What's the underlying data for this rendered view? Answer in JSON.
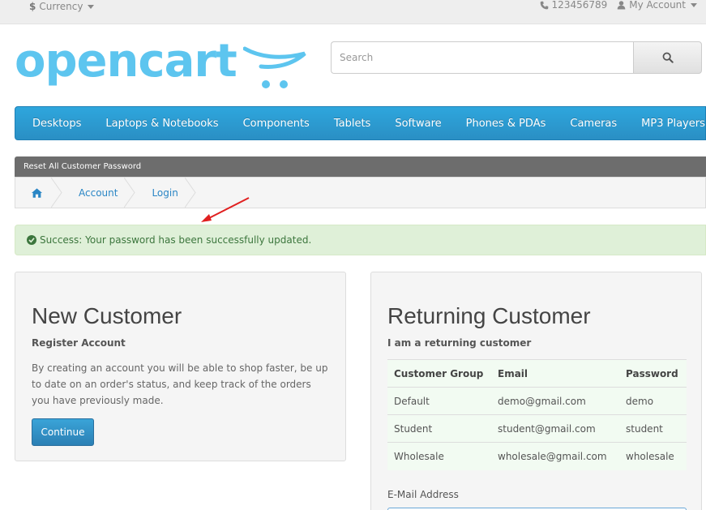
{
  "topbar": {
    "currency_symbol": "$",
    "currency_label": "Currency",
    "phone": "123456789",
    "account_label": "My Account"
  },
  "logo": {
    "text": "opencart"
  },
  "search": {
    "placeholder": "Search"
  },
  "menu": {
    "items": [
      "Desktops",
      "Laptops & Notebooks",
      "Components",
      "Tablets",
      "Software",
      "Phones & PDAs",
      "Cameras",
      "MP3 Players"
    ]
  },
  "banner": {
    "text": "Reset All Customer Password"
  },
  "breadcrumb": {
    "items": [
      "Account",
      "Login"
    ]
  },
  "alert": {
    "text": "Success: Your password has been successfully updated."
  },
  "new_customer": {
    "title": "New Customer",
    "subtitle": "Register Account",
    "body": "By creating an account you will be able to shop faster, be up to date on an order's status, and keep track of the orders you have previously made.",
    "button": "Continue"
  },
  "returning_customer": {
    "title": "Returning Customer",
    "subtitle": "I am a returning customer",
    "table": {
      "headers": [
        "Customer Group",
        "Email",
        "Password"
      ],
      "rows": [
        [
          "Default",
          "demo@gmail.com",
          "demo"
        ],
        [
          "Student",
          "student@gmail.com",
          "student"
        ],
        [
          "Wholesale",
          "wholesale@gmail.com",
          "wholesale"
        ]
      ]
    },
    "email_label": "E-Mail Address"
  },
  "colors": {
    "brand_blue": "#2ea6dd",
    "logo_blue": "#5dc5ef",
    "success_bg": "#dff0d8",
    "success_text": "#3c763d",
    "annotation_red": "#e02020"
  }
}
